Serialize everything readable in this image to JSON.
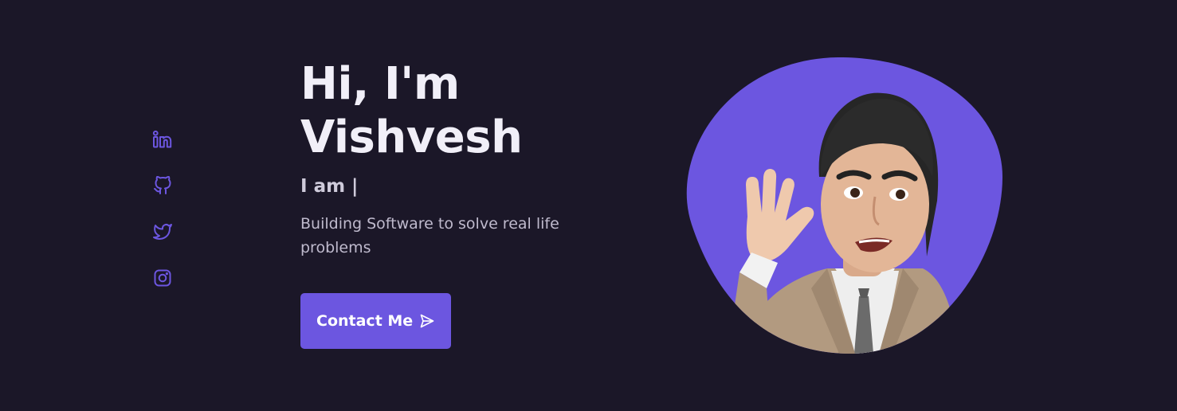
{
  "socials": [
    {
      "name": "linkedin-icon"
    },
    {
      "name": "github-icon"
    },
    {
      "name": "twitter-icon"
    },
    {
      "name": "instagram-icon"
    }
  ],
  "hero": {
    "title_line1": "Hi, I'm",
    "title_line2": "Vishvesh",
    "subtitle": "I am |",
    "description": "Building Software to solve real life problems",
    "button_label": "Contact Me",
    "button_icon": "send-icon"
  },
  "avatar": {
    "blob_color": "#6c56e0",
    "description": "memoji-avatar-waving"
  },
  "colors": {
    "background": "#1b1728",
    "accent": "#6c56e0",
    "text_primary": "#f1eff8",
    "text_secondary": "#bfbacd"
  }
}
